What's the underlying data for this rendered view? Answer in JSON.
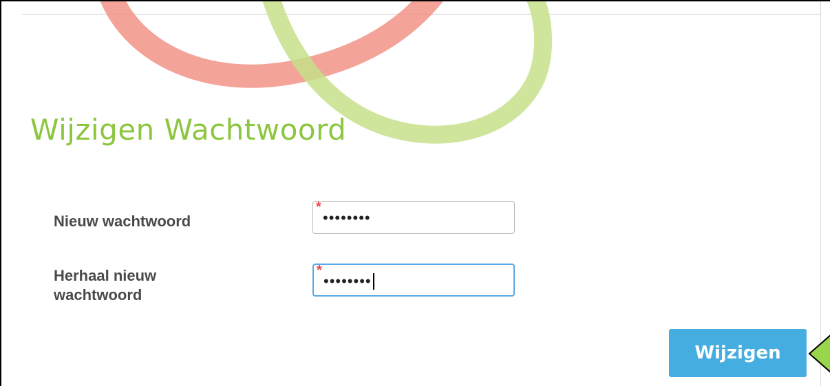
{
  "page": {
    "title": "Wijzigen Wachtwoord"
  },
  "form": {
    "new_password": {
      "label": "Nieuw wachtwoord",
      "value": "••••••••",
      "required_marker": "*"
    },
    "repeat_password": {
      "label": "Herhaal nieuw wachtwoord",
      "value": "••••••••",
      "required_marker": "*"
    },
    "submit_label": "Wijzigen"
  },
  "colors": {
    "title": "#8cc63f",
    "button": "#45ade0",
    "required": "#e8474a",
    "decor_red": "#f08c7e",
    "decor_green": "#c6e08a",
    "pointer": "#9ad64b"
  },
  "icons": {
    "callout": "pointer-arrow-icon"
  }
}
